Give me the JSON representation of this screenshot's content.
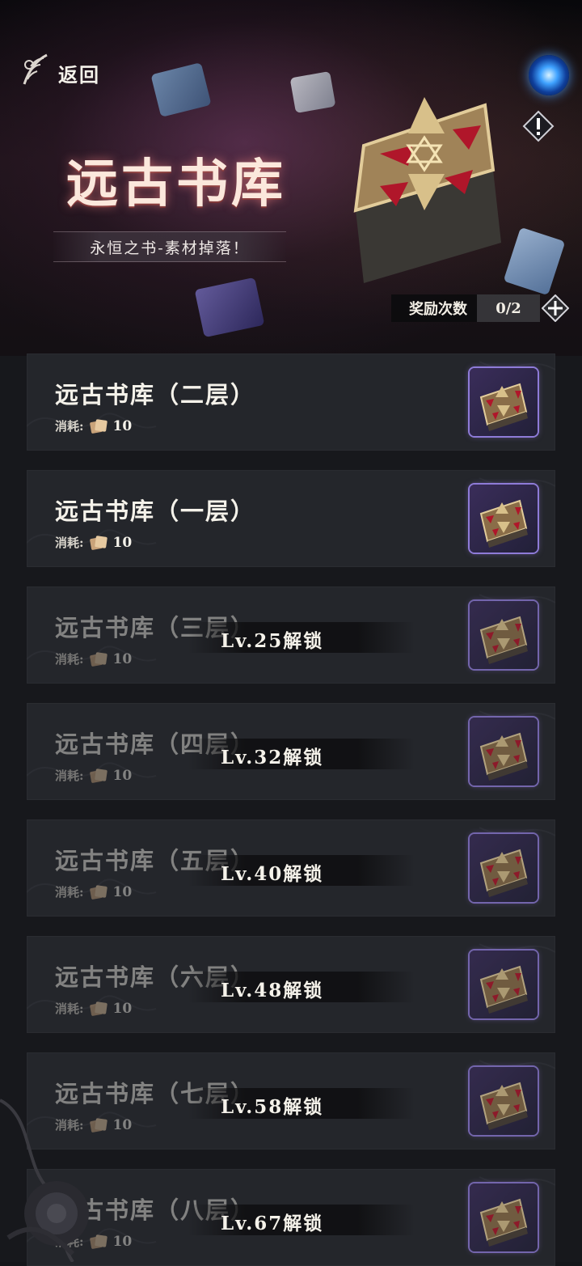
{
  "header": {
    "back_label": "返回",
    "title": "远古书库",
    "subtitle": "永恒之书-素材掉落！",
    "reward": {
      "label": "奖励次数",
      "value": "0/2"
    }
  },
  "colors": {
    "background": "#15161a",
    "card": "#24262b",
    "thumb_border": "#8e7bd8",
    "text": "#f5f2ea"
  },
  "icons": {
    "back": "rose-feather-icon",
    "portal": "blue-portal-icon",
    "alert": "exclamation-icon",
    "add": "plus-diamond-icon",
    "cost": "book-pages-icon"
  },
  "levels": [
    {
      "name": "远古书库（二层）",
      "cost_label": "消耗:",
      "cost_value": "10",
      "locked": false,
      "lock_text": ""
    },
    {
      "name": "远古书库（一层）",
      "cost_label": "消耗:",
      "cost_value": "10",
      "locked": false,
      "lock_text": ""
    },
    {
      "name": "远古书库（三层）",
      "cost_label": "消耗:",
      "cost_value": "10",
      "locked": true,
      "lock_text": "Lv.25解锁"
    },
    {
      "name": "远古书库（四层）",
      "cost_label": "消耗:",
      "cost_value": "10",
      "locked": true,
      "lock_text": "Lv.32解锁"
    },
    {
      "name": "远古书库（五层）",
      "cost_label": "消耗:",
      "cost_value": "10",
      "locked": true,
      "lock_text": "Lv.40解锁"
    },
    {
      "name": "远古书库（六层）",
      "cost_label": "消耗:",
      "cost_value": "10",
      "locked": true,
      "lock_text": "Lv.48解锁"
    },
    {
      "name": "远古书库（七层）",
      "cost_label": "消耗:",
      "cost_value": "10",
      "locked": true,
      "lock_text": "Lv.58解锁"
    },
    {
      "name": "远古书库（八层）",
      "cost_label": "消耗:",
      "cost_value": "10",
      "locked": true,
      "lock_text": "Lv.67解锁"
    }
  ]
}
